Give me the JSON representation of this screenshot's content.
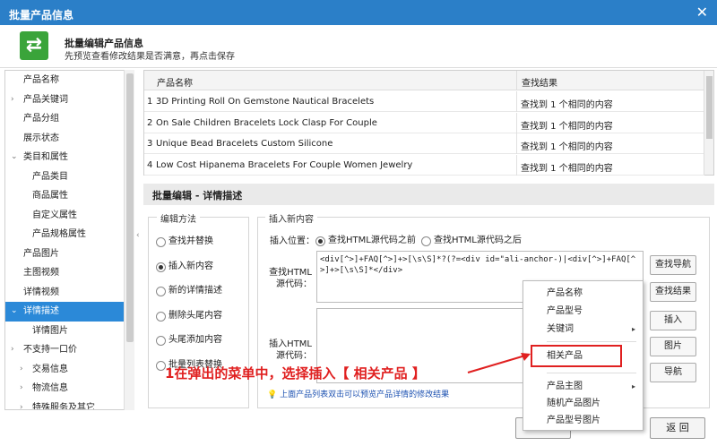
{
  "window": {
    "title": "批量产品信息",
    "close": "✕"
  },
  "header": {
    "title": "批量编辑产品信息",
    "subtitle": "先预览查看修改结果是否满意，再点击保存",
    "logo": "⇄"
  },
  "sidebar": {
    "items": [
      {
        "label": "产品名称",
        "arrow": "",
        "sub": false,
        "active": false
      },
      {
        "label": "产品关键词",
        "arrow": "›",
        "sub": false,
        "active": false
      },
      {
        "label": "产品分组",
        "arrow": "",
        "sub": false,
        "active": false
      },
      {
        "label": "展示状态",
        "arrow": "",
        "sub": false,
        "active": false
      },
      {
        "label": "类目和属性",
        "arrow": "⌄",
        "sub": false,
        "active": false
      },
      {
        "label": "产品类目",
        "arrow": "",
        "sub": true,
        "active": false
      },
      {
        "label": "商品属性",
        "arrow": "",
        "sub": true,
        "active": false
      },
      {
        "label": "自定义属性",
        "arrow": "",
        "sub": true,
        "active": false
      },
      {
        "label": "产品规格属性",
        "arrow": "",
        "sub": true,
        "active": false
      },
      {
        "label": "产品图片",
        "arrow": "",
        "sub": false,
        "active": false
      },
      {
        "label": "主图视频",
        "arrow": "",
        "sub": false,
        "active": false
      },
      {
        "label": "详情视频",
        "arrow": "",
        "sub": false,
        "active": false
      },
      {
        "label": "详情描述",
        "arrow": "⌄",
        "sub": false,
        "active": true
      },
      {
        "label": "详情图片",
        "arrow": "",
        "sub": true,
        "active": false
      },
      {
        "label": "不支持一口价",
        "arrow": "›",
        "sub": false,
        "active": false
      },
      {
        "label": "交易信息",
        "arrow": "›",
        "sub": true,
        "active": false
      },
      {
        "label": "物流信息",
        "arrow": "›",
        "sub": true,
        "active": false
      },
      {
        "label": "特殊服务及其它",
        "arrow": "›",
        "sub": true,
        "active": false
      }
    ]
  },
  "grid": {
    "headers": {
      "name": "产品名称",
      "result": "查找结果"
    },
    "rows": [
      {
        "num": "1",
        "name": "3D Printing Roll On Gemstone Nautical Bracelets",
        "result": "查找到 1 个相同的内容"
      },
      {
        "num": "2",
        "name": "On Sale Children Bracelets Lock Clasp For Couple",
        "result": "查找到 1 个相同的内容"
      },
      {
        "num": "3",
        "name": "Unique Bead Bracelets Custom Silicone",
        "result": "查找到 1 个相同的内容"
      },
      {
        "num": "4",
        "name": "Low Cost Hipanema Bracelets For Couple Women Jewelry",
        "result": "查找到 1 个相同的内容"
      }
    ]
  },
  "section": {
    "title": "批量编辑 - 详情描述"
  },
  "method": {
    "legend": "编辑方法",
    "options": [
      "查找并替换",
      "插入新内容",
      "新的详情描述",
      "删除头尾内容",
      "头尾添加内容",
      "批量列表替换"
    ],
    "selected": 1
  },
  "insert": {
    "legend": "插入新内容",
    "position_label": "插入位置：",
    "pos_before": "查找HTML源代码之前",
    "pos_after": "查找HTML源代码之后",
    "find_label": "查找HTML\n源代码：",
    "find_code": "<div[^>]+FAQ[^>]+>[\\s\\S]*?(?=<div id=\"ali-anchor-)|<div[^>]+FAQ[^>]+>[\\s\\S]*</div>",
    "insert_label": "插入HTML\n源代码：",
    "insert_code": ""
  },
  "buttons": {
    "find_nav": "查找导航",
    "find_result": "查找结果",
    "insert": "插入",
    "image": "图片",
    "nav": "导航"
  },
  "context_menu": {
    "items": [
      "产品名称",
      "产品型号",
      "关键词",
      "相关产品",
      "产品主图",
      "随机产品图片",
      "产品型号图片"
    ],
    "submenu_arrow": "▸"
  },
  "annotation": "1在弹出的菜单中，选择插入【 相关产品 】",
  "hint": {
    "icon": "💡",
    "text": "上面产品列表双击可以预览产品详情的修改结果"
  },
  "footer": {
    "back": "返 回"
  },
  "colors": {
    "accent": "#2b7fc8",
    "selected": "#2b89d8",
    "annotation": "#e02020"
  }
}
